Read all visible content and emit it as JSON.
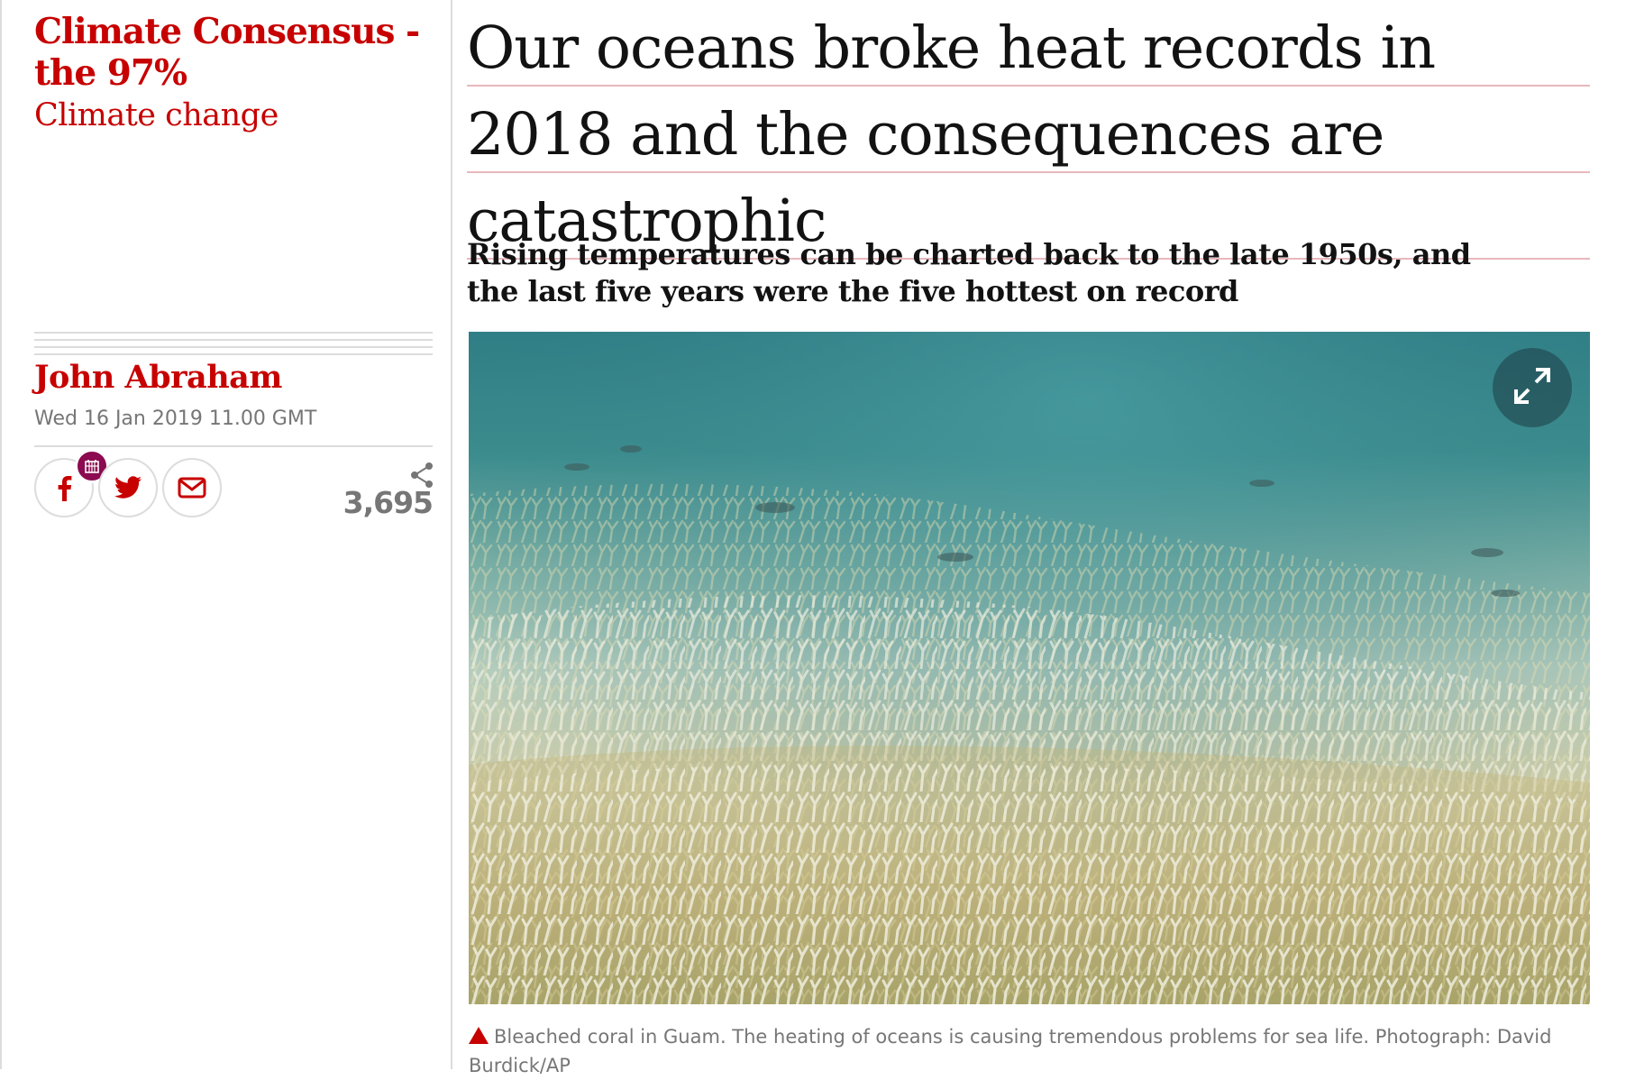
{
  "series": {
    "title": "Climate Consensus - the 97%",
    "section": "Climate change"
  },
  "byline": {
    "author": "John Abraham",
    "date": "Wed 16 Jan 2019 11.00 GMT"
  },
  "share": {
    "facebook_icon": "facebook-icon",
    "twitter_icon": "twitter-icon",
    "email_icon": "email-icon",
    "count": "3,695"
  },
  "article": {
    "headline": "Our oceans broke heat records in 2018 and the consequences are catastrophic",
    "standfirst": "Rising temperatures can be charted back to the late 1950s, and the last five years were the five hottest on record",
    "caption": "Bleached coral in Guam. The heating of oceans is causing tremendous problems for sea life. Photograph: David Burdick/AP"
  },
  "colors": {
    "accent": "#c70000",
    "text": "#121212",
    "muted": "#767676",
    "rule": "#dcdcdc",
    "badge": "#8b0a50"
  }
}
